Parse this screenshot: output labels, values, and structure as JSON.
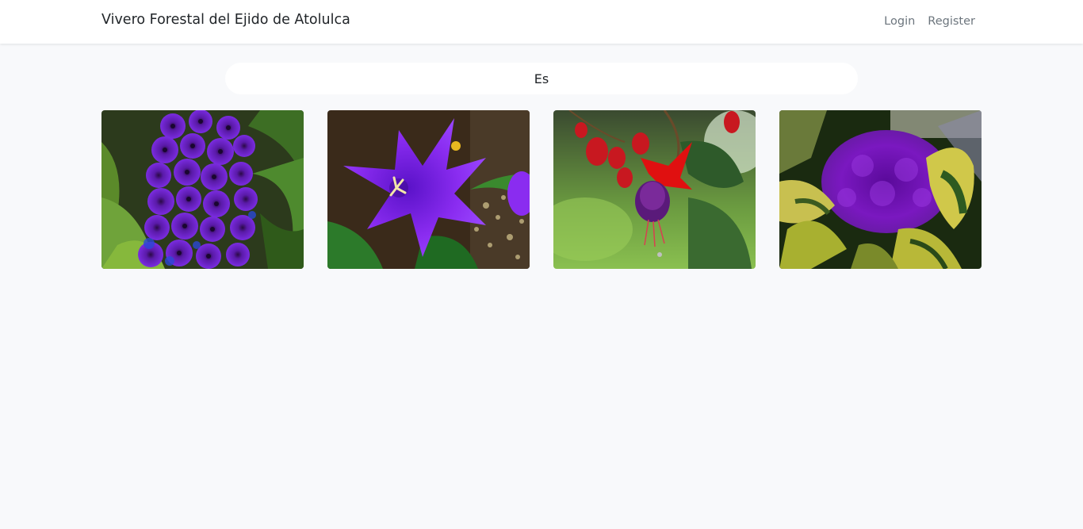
{
  "navbar": {
    "brand": "Vivero Forestal del Ejido de Atolulca",
    "links": [
      {
        "label": "Login"
      },
      {
        "label": "Register"
      }
    ]
  },
  "search": {
    "value": "Es"
  },
  "gallery": {
    "items": [
      {
        "subject": "purple-delphinium-photo"
      },
      {
        "subject": "purple-balloon-flower-photo"
      },
      {
        "subject": "red-purple-fuchsia-photo"
      },
      {
        "subject": "purple-ornamental-cabbage-photo"
      }
    ]
  }
}
